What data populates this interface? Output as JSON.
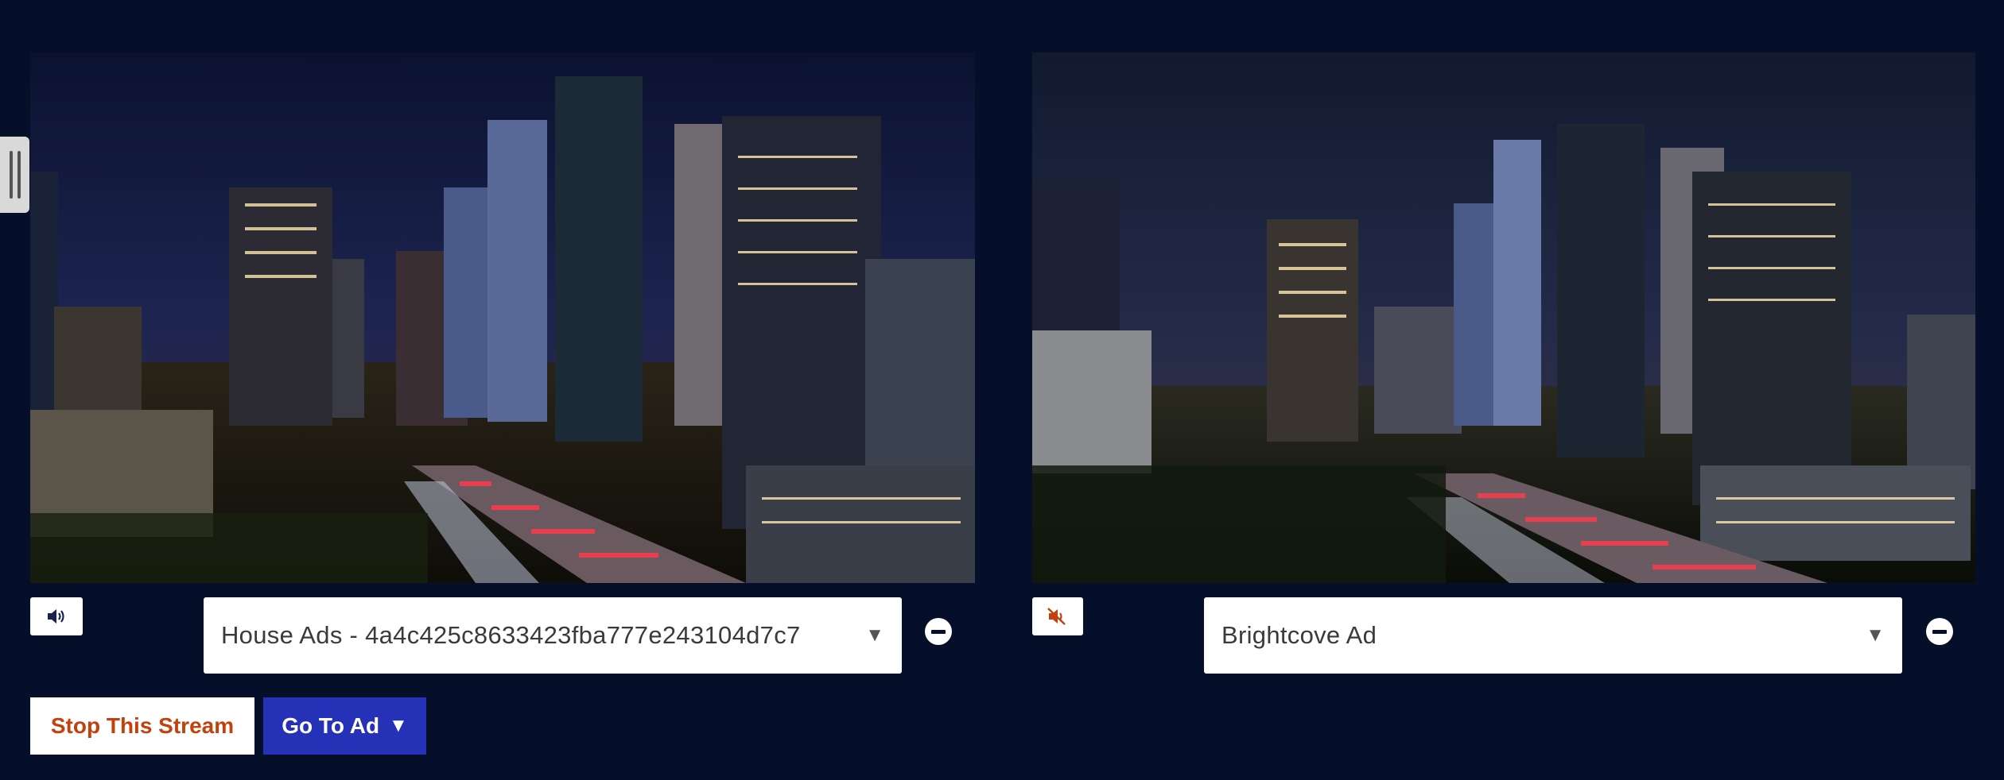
{
  "players": [
    {
      "audio_state": "unmuted",
      "audio_icon": "speaker-icon",
      "selected_ad": "House Ads - 4a4c425c8633423fba777e243104d7c7"
    },
    {
      "audio_state": "muted",
      "audio_icon": "speaker-muted-icon",
      "selected_ad": "Brightcove Ad"
    }
  ],
  "controls": {
    "stop_label": "Stop This Stream",
    "goto_label": "Go To Ad",
    "goto_arrow": "▼",
    "select_caret": "▼"
  },
  "colors": {
    "background": "#060f2a",
    "stop_text": "#c2410c",
    "goto_bg": "#2532b8"
  }
}
